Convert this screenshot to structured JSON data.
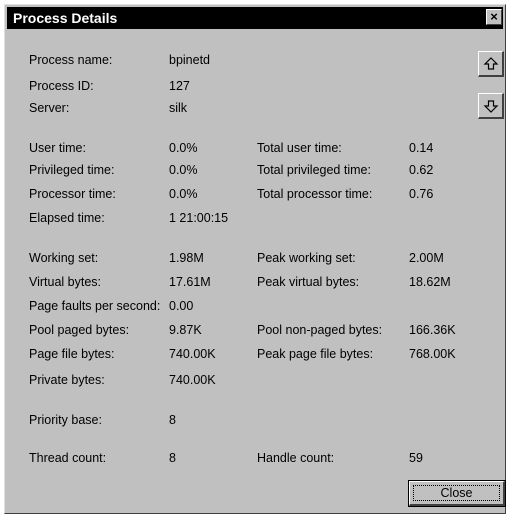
{
  "window": {
    "title": "Process Details",
    "close_glyph": "×"
  },
  "fields": {
    "process_name": {
      "label": "Process name:",
      "value": "bpinetd"
    },
    "process_id": {
      "label": "Process ID:",
      "value": "127"
    },
    "server": {
      "label": "Server:",
      "value": "silk"
    },
    "user_time": {
      "label": "User time:",
      "value": "0.0%"
    },
    "total_user_time": {
      "label": "Total user time:",
      "value": "0.14"
    },
    "privileged_time": {
      "label": "Privileged time:",
      "value": "0.0%"
    },
    "total_privileged_time": {
      "label": "Total privileged time:",
      "value": "0.62"
    },
    "processor_time": {
      "label": "Processor time:",
      "value": "0.0%"
    },
    "total_processor_time": {
      "label": "Total processor time:",
      "value": "0.76"
    },
    "elapsed_time": {
      "label": "Elapsed time:",
      "value": "1 21:00:15"
    },
    "working_set": {
      "label": "Working set:",
      "value": "1.98M"
    },
    "peak_working_set": {
      "label": "Peak working set:",
      "value": "2.00M"
    },
    "virtual_bytes": {
      "label": "Virtual bytes:",
      "value": "17.61M"
    },
    "peak_virtual_bytes": {
      "label": "Peak virtual bytes:",
      "value": "18.62M"
    },
    "page_faults": {
      "label": "Page faults per second:",
      "value": "0.00"
    },
    "pool_paged_bytes": {
      "label": "Pool paged bytes:",
      "value": "9.87K"
    },
    "pool_nonpaged_bytes": {
      "label": "Pool non-paged bytes:",
      "value": "166.36K"
    },
    "page_file_bytes": {
      "label": "Page file bytes:",
      "value": "740.00K"
    },
    "peak_page_file_bytes": {
      "label": "Peak page file bytes:",
      "value": "768.00K"
    },
    "private_bytes": {
      "label": "Private bytes:",
      "value": "740.00K"
    },
    "priority_base": {
      "label": "Priority base:",
      "value": "8"
    },
    "thread_count": {
      "label": "Thread count:",
      "value": "8"
    },
    "handle_count": {
      "label": "Handle count:",
      "value": "59"
    }
  },
  "buttons": {
    "close_label": "Close"
  },
  "icons": {
    "up": "arrow-up-icon",
    "down": "arrow-down-icon"
  }
}
